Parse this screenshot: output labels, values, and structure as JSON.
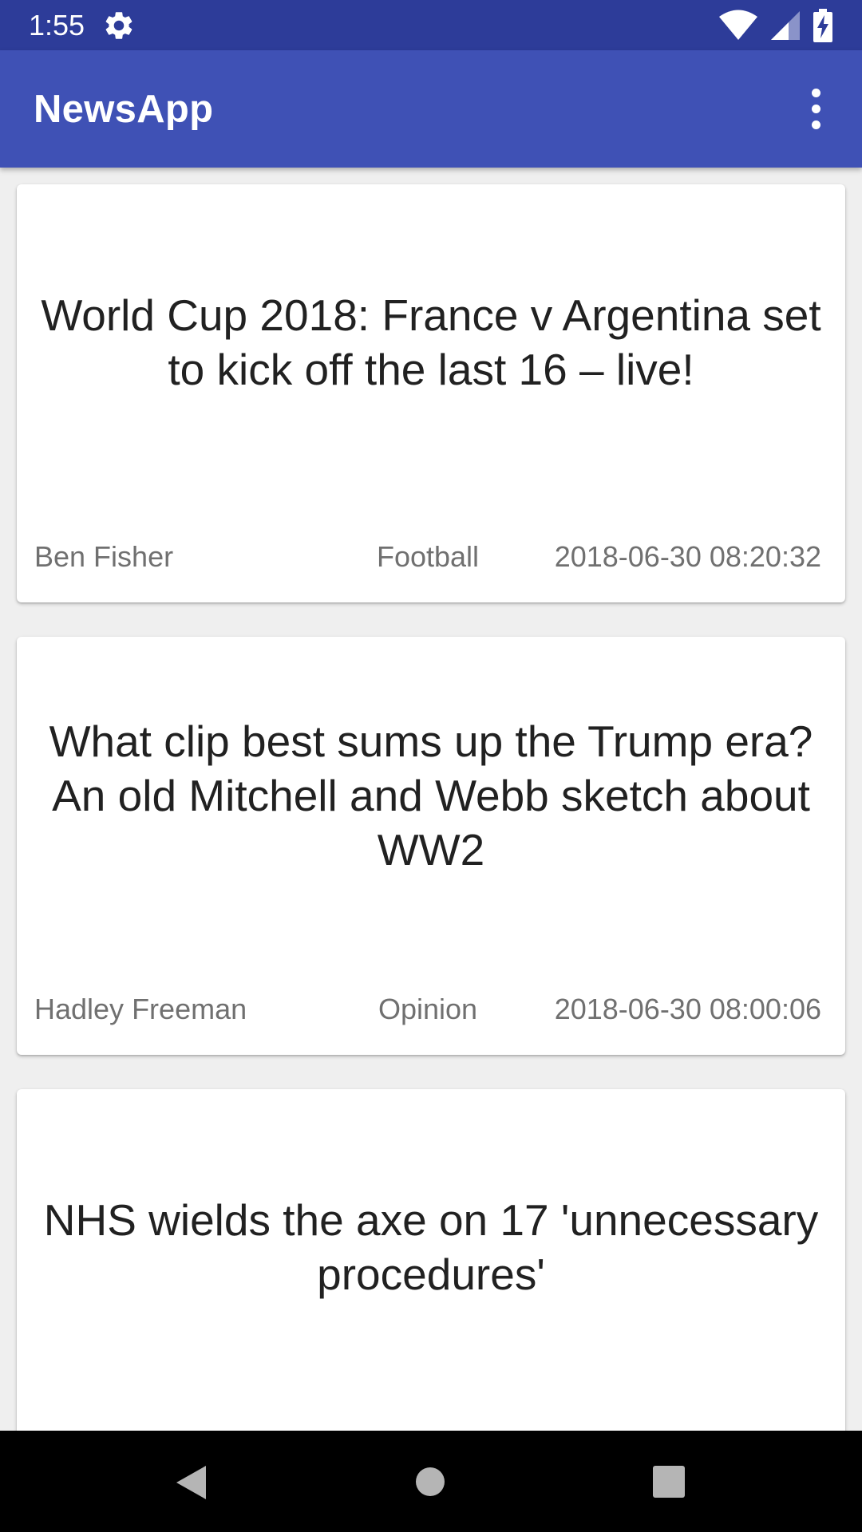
{
  "status_bar": {
    "time": "1:55",
    "icons": [
      "settings-gear-icon",
      "wifi-icon",
      "cell-signal-icon",
      "battery-charging-icon"
    ]
  },
  "app_bar": {
    "title": "NewsApp",
    "overflow_icon": "more-vert-icon"
  },
  "articles": [
    {
      "title": "World Cup 2018: France v Argentina set to kick off the last 16 – live!",
      "author": "Ben Fisher",
      "section": "Football",
      "date": "2018-06-30 08:20:32"
    },
    {
      "title": "What clip best sums up the Trump era? An old Mitchell and Webb sketch about WW2",
      "author": "Hadley Freeman",
      "section": "Opinion",
      "date": "2018-06-30 08:00:06"
    },
    {
      "title": "NHS wields the axe on 17 'unnecessary procedures'"
    }
  ],
  "nav_bar": {
    "icons": [
      "back-icon",
      "home-icon",
      "recents-icon"
    ]
  },
  "colors": {
    "status_bar": "#2d3c99",
    "app_bar": "#3f51b5",
    "background": "#efefef",
    "card": "#ffffff",
    "title_text": "#212121",
    "meta_text": "#707070"
  }
}
